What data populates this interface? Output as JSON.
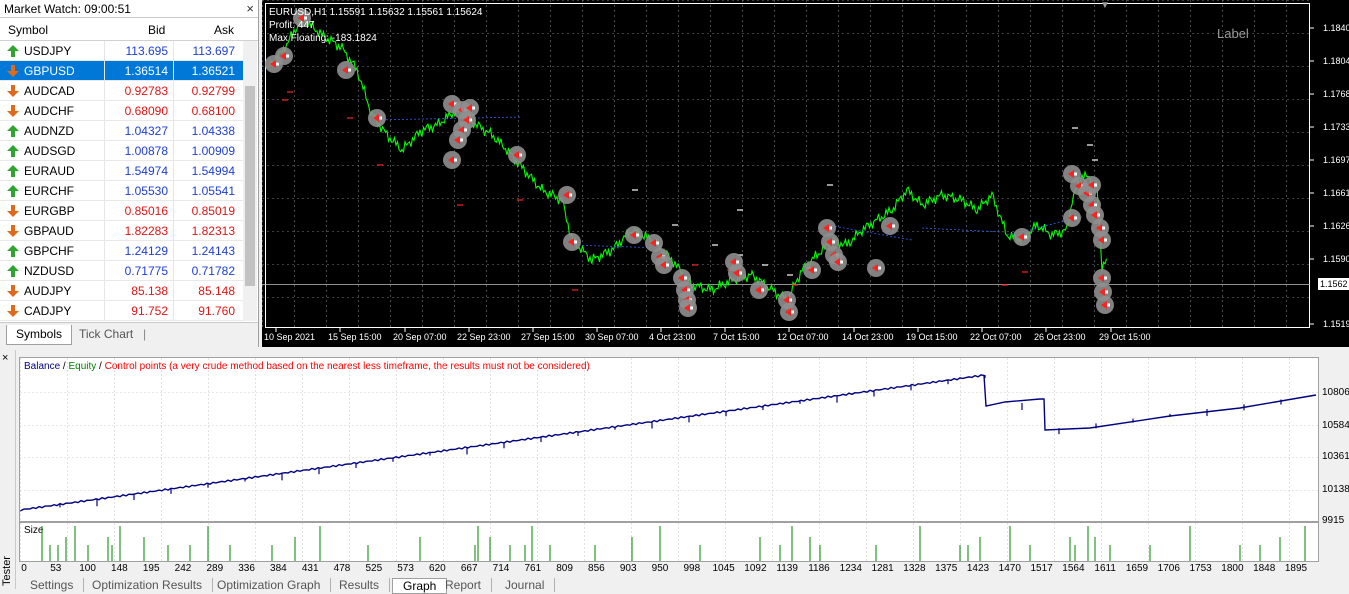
{
  "market_watch": {
    "title": "Market Watch: 09:00:51",
    "close_glyph": "×",
    "headers": {
      "symbol": "Symbol",
      "bid": "Bid",
      "ask": "Ask"
    },
    "rows": [
      {
        "symbol": "USDJPY",
        "bid": "113.695",
        "ask": "113.697",
        "dir": "up",
        "color": "blue"
      },
      {
        "symbol": "GBPUSD",
        "bid": "1.36514",
        "ask": "1.36521",
        "dir": "down",
        "color": "selected"
      },
      {
        "symbol": "AUDCAD",
        "bid": "0.92783",
        "ask": "0.92799",
        "dir": "down",
        "color": "red"
      },
      {
        "symbol": "AUDCHF",
        "bid": "0.68090",
        "ask": "0.68100",
        "dir": "down",
        "color": "red"
      },
      {
        "symbol": "AUDNZD",
        "bid": "1.04327",
        "ask": "1.04338",
        "dir": "up",
        "color": "blue"
      },
      {
        "symbol": "AUDSGD",
        "bid": "1.00878",
        "ask": "1.00909",
        "dir": "up",
        "color": "blue"
      },
      {
        "symbol": "EURAUD",
        "bid": "1.54974",
        "ask": "1.54994",
        "dir": "up",
        "color": "blue"
      },
      {
        "symbol": "EURCHF",
        "bid": "1.05530",
        "ask": "1.05541",
        "dir": "up",
        "color": "blue"
      },
      {
        "symbol": "EURGBP",
        "bid": "0.85016",
        "ask": "0.85019",
        "dir": "down",
        "color": "red"
      },
      {
        "symbol": "GBPAUD",
        "bid": "1.82283",
        "ask": "1.82313",
        "dir": "down",
        "color": "red"
      },
      {
        "symbol": "GBPCHF",
        "bid": "1.24129",
        "ask": "1.24143",
        "dir": "up",
        "color": "blue"
      },
      {
        "symbol": "NZDUSD",
        "bid": "0.71775",
        "ask": "0.71782",
        "dir": "up",
        "color": "blue"
      },
      {
        "symbol": "AUDJPY",
        "bid": "85.138",
        "ask": "85.148",
        "dir": "down",
        "color": "red"
      },
      {
        "symbol": "CADJPY",
        "bid": "91.752",
        "ask": "91.760",
        "dir": "down",
        "color": "red"
      }
    ],
    "tabs": [
      "Symbols",
      "Tick Chart"
    ]
  },
  "chart": {
    "header_line": "EURUSD,H1  1.15591 1.15632 1.15561 1.15624",
    "profit_line": "Profit: 447",
    "floating_line": "Max Floating: -183.1824",
    "label_text": "Label",
    "current_price": "1.1562",
    "price_ticks": [
      "1.1840",
      "1.1804",
      "1.1768",
      "1.1733",
      "1.1697",
      "1.1661",
      "1.1626",
      "1.1590",
      "1.1519"
    ],
    "time_ticks": [
      "10 Sep 2021",
      "15 Sep 15:00",
      "20 Sep 07:00",
      "22 Sep 23:00",
      "27 Sep 15:00",
      "30 Sep 07:00",
      "4 Oct 23:00",
      "7 Oct 15:00",
      "12 Oct 07:00",
      "14 Oct 23:00",
      "19 Oct 15:00",
      "22 Oct 07:00",
      "26 Oct 23:00",
      "29 Oct 15:00"
    ],
    "colors": {
      "background": "#000000",
      "line": "#00ff00",
      "grid": "#9aa0a6",
      "sl_mark": "#ff2020",
      "tp_mark": "#ffffff"
    }
  },
  "tester_graph": {
    "legend_balance": "Balance",
    "legend_sep1": " / ",
    "legend_equity": "Equity",
    "legend_sep2": " / ",
    "legend_control": "Control points (a very crude method based on the nearest less timeframe, the results must not be considered)",
    "size_label": "Size",
    "y_ticks": [
      "10806",
      "10584",
      "10361",
      "10138",
      "9915"
    ],
    "x_ticks": [
      "0",
      "53",
      "100",
      "148",
      "195",
      "242",
      "289",
      "336",
      "384",
      "431",
      "478",
      "525",
      "573",
      "620",
      "667",
      "714",
      "761",
      "809",
      "856",
      "903",
      "950",
      "998",
      "1045",
      "1092",
      "1139",
      "1186",
      "1234",
      "1281",
      "1328",
      "1375",
      "1423",
      "1470",
      "1517",
      "1564",
      "1611",
      "1659",
      "1706",
      "1753",
      "1800",
      "1848",
      "1895"
    ],
    "colors": {
      "balance": "#000080",
      "equity": "#008000",
      "control": "#ff0000",
      "size": "#008000"
    }
  },
  "side_label": "Tester",
  "bottom_tabs": [
    "Settings",
    "Optimization Results",
    "Optimization Graph",
    "Results",
    "Graph",
    "Report",
    "Journal"
  ],
  "active_bottom_tab": "Graph"
}
